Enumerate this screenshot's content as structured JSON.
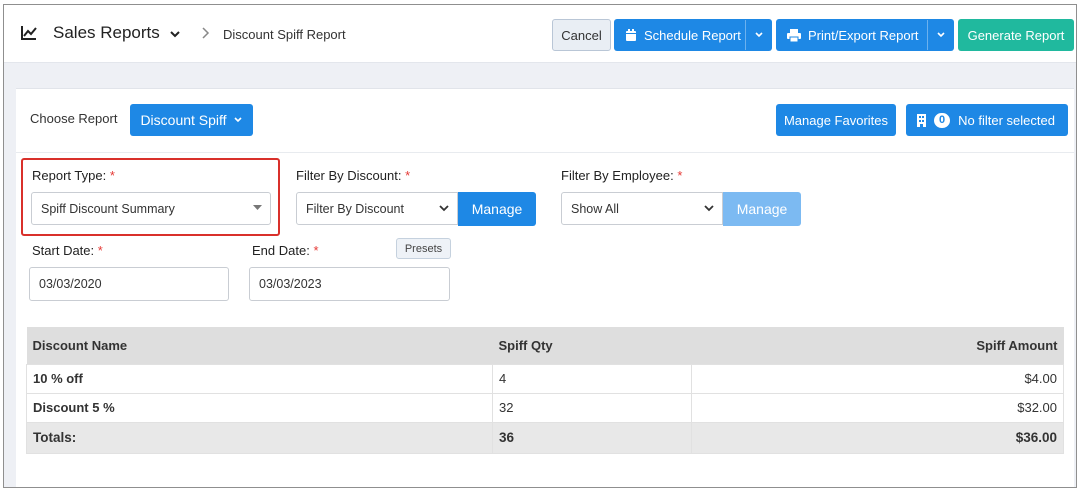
{
  "header": {
    "title": "Sales Reports",
    "breadcrumb": "Discount Spiff Report",
    "cancel_label": "Cancel",
    "schedule_label": "Schedule Report",
    "print_label": "Print/Export Report",
    "generate_label": "Generate Report"
  },
  "report_bar": {
    "choose_label": "Choose Report",
    "selected_report": "Discount Spiff",
    "favorites_label": "Manage Favorites",
    "filter_count": "0",
    "filter_label": "No filter selected"
  },
  "filters": {
    "report_type_label": "Report Type:",
    "report_type_value": "Spiff Discount Summary",
    "discount_label": "Filter By Discount:",
    "discount_value": "Filter By Discount",
    "discount_manage": "Manage",
    "employee_label": "Filter By Employee:",
    "employee_value": "Show All",
    "employee_manage": "Manage",
    "required_mark": "*",
    "start_label": "Start Date:",
    "start_value": "03/03/2020",
    "end_label": "End Date:",
    "end_value": "03/03/2023",
    "presets_label": "Presets"
  },
  "table": {
    "columns": [
      "Discount Name",
      "Spiff Qty",
      "Spiff Amount"
    ],
    "rows": [
      [
        "10 % off",
        "4",
        "$4.00"
      ],
      [
        "Discount 5 %",
        "32",
        "$32.00"
      ]
    ],
    "totals": [
      "Totals:",
      "36",
      "$36.00"
    ]
  },
  "colors": {
    "primary": "#1e88e5",
    "generate": "#20b99e",
    "manage_disabled": "#7cbaf2",
    "highlight_border": "#d9302b",
    "required": "#e53935"
  },
  "icons": {
    "title": "line-chart-icon",
    "schedule": "calendar-icon",
    "print": "printer-icon",
    "filter": "building-icon"
  }
}
